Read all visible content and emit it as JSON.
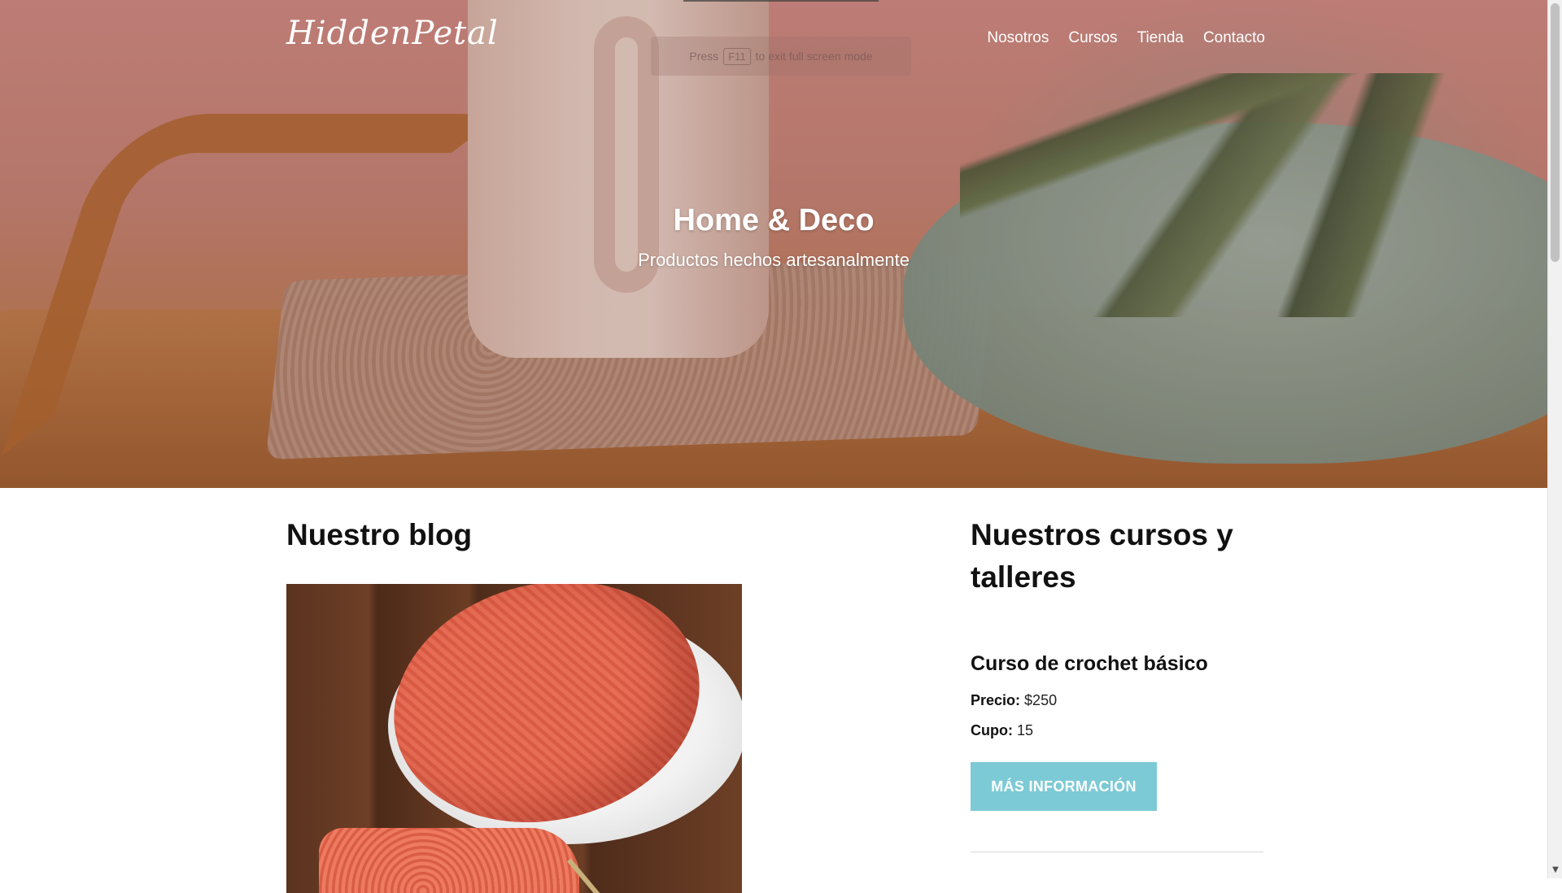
{
  "header": {
    "brand": "HiddenPetal",
    "nav": [
      {
        "label": "Nosotros"
      },
      {
        "label": "Cursos"
      },
      {
        "label": "Tienda"
      },
      {
        "label": "Contacto"
      }
    ]
  },
  "fullscreen_notice": {
    "press": "Press",
    "key": "F11",
    "rest": "to exit full screen mode"
  },
  "hero": {
    "title": "Home & Deco",
    "subtitle": "Productos hechos artesanalmente"
  },
  "blog": {
    "title": "Nuestro blog"
  },
  "courses": {
    "title": "Nuestros cursos y talleres",
    "items": [
      {
        "name": "Curso de crochet básico",
        "price_label": "Precio:",
        "price_value": "$250",
        "capacity_label": "Cupo:",
        "capacity_value": "15",
        "button_label": "MÁS INFORMACIÓN"
      }
    ]
  },
  "colors": {
    "accent_button": "#7ccad6",
    "text": "#111111"
  }
}
